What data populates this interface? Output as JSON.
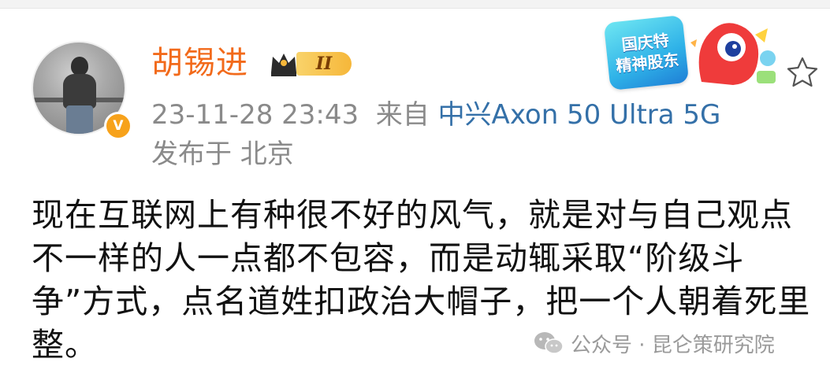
{
  "user": {
    "name": "胡锡进",
    "vip_level": "II",
    "verified_mark": "V"
  },
  "post_meta": {
    "timestamp": "23-11-28 23:43",
    "source_prefix": "来自",
    "device": "中兴Axon 50 Ultra 5G",
    "location": "发布于 北京"
  },
  "promo_badge": {
    "line1": "国庆特",
    "line2": "精神股东"
  },
  "post": {
    "text": "现在互联网上有种很不好的风气，就是对与自己观点不一样的人一点都不包容，而是动辄采取“阶级斗争”方式，点名道姓扣政治大帽子，把一个人朝着死里整。"
  },
  "watermark": {
    "text": "公众号 · 昆仑策研究院"
  },
  "colors": {
    "name": "#f26a1b",
    "meta": "#8a8a8a",
    "device": "#3470a8",
    "body_text": "#111111",
    "verify": "#f7a21b"
  },
  "icons": {
    "verify": "verified-v-icon",
    "crown": "crown-icon",
    "favorite": "star-outline-icon",
    "watermark": "wechat-icon"
  }
}
